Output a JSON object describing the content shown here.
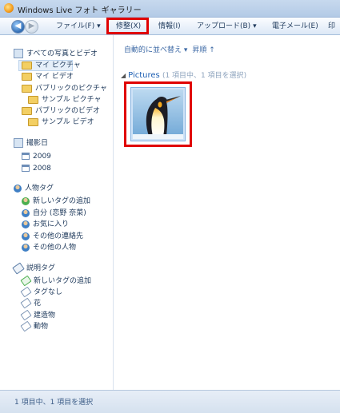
{
  "window": {
    "title": "Windows Live フォト ギャラリー"
  },
  "menu": {
    "file": "ファイル(F)",
    "fix": "修整(X)",
    "info": "情報(I)",
    "upload": "アップロード(B)",
    "email": "電子メール(E)",
    "print": "印"
  },
  "sidebar": {
    "all": "すべての写真とビデオ",
    "my_pictures": "マイ ピクチャ",
    "my_videos": "マイ ビデオ",
    "public_pictures": "パブリックのピクチャ",
    "sample_pictures": "サンプル ピクチャ",
    "public_videos": "パブリックのビデオ",
    "sample_videos": "サンプル ビデオ",
    "date_taken": "撮影日",
    "years": [
      "2009",
      "2008"
    ],
    "people_tags": "人物タグ",
    "people": [
      "新しいタグの追加",
      "自分 (恋野 奈菜)",
      "お気に入り",
      "その他の連絡先",
      "その他の人物"
    ],
    "descriptive_tags": "説明タグ",
    "descriptive": [
      "新しいタグの追加",
      "タグなし",
      "花",
      "建造物",
      "動物"
    ]
  },
  "main": {
    "arrange": "自動的に並べ替え",
    "sort": "昇順",
    "group_name": "Pictures",
    "group_count": "(1 項目中、1 項目を選択)"
  },
  "status": {
    "text": "1 項目中、1 項目を選択"
  },
  "colors": {
    "highlight": "#e00000",
    "link": "#1e5fb3"
  }
}
